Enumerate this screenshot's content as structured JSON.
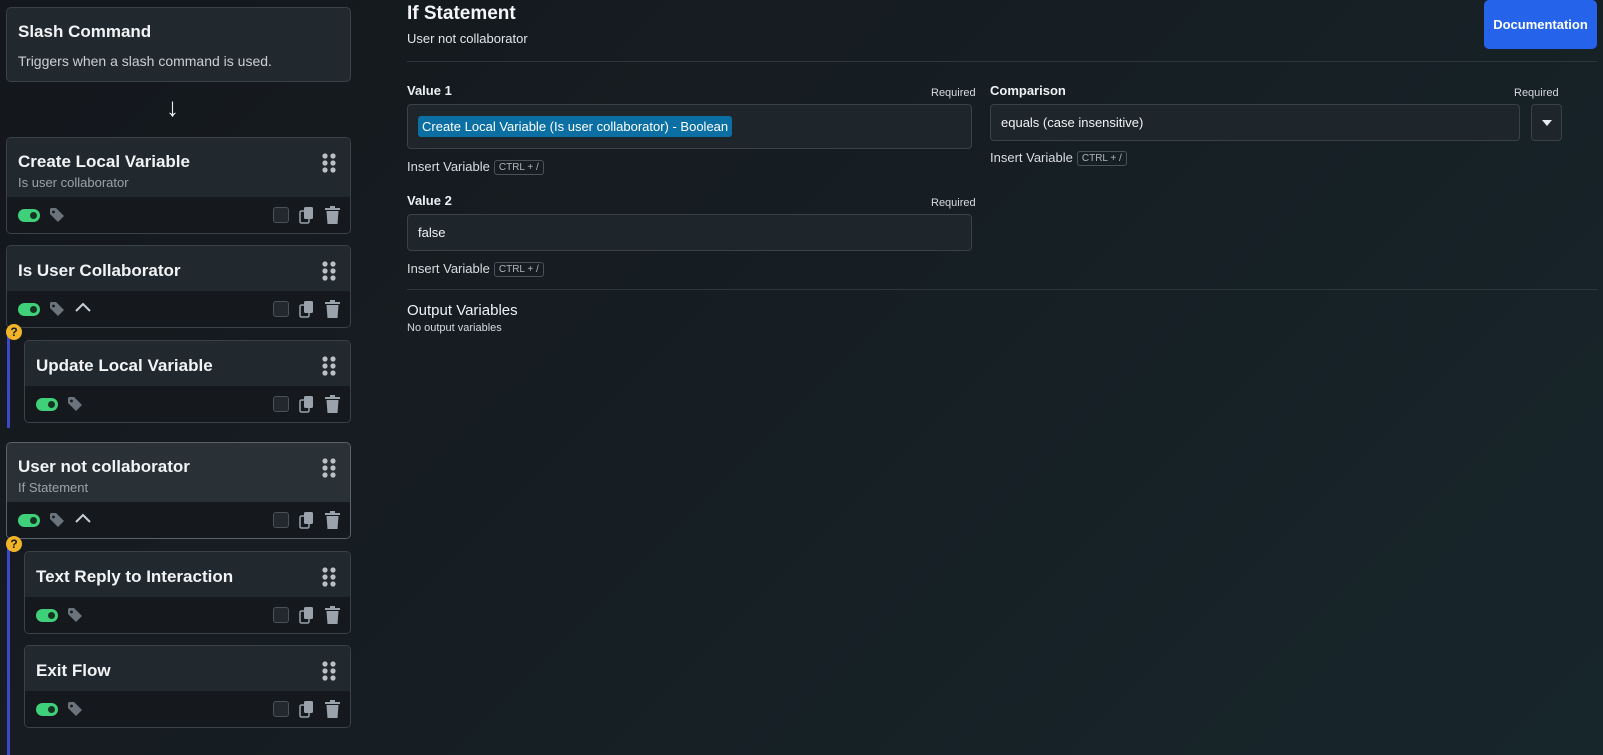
{
  "sidebar": {
    "trigger": {
      "title": "Slash Command",
      "description": "Triggers when a slash command is used."
    },
    "arrow": "↓",
    "blocks": [
      {
        "title": "Create Local Variable",
        "subtitle": "Is user collaborator"
      },
      {
        "title": "Is User Collaborator",
        "subtitle": ""
      },
      {
        "title": "Update Local Variable",
        "subtitle": ""
      },
      {
        "title": "User not collaborator",
        "subtitle": "If Statement"
      },
      {
        "title": "Text Reply to Interaction",
        "subtitle": ""
      },
      {
        "title": "Exit Flow",
        "subtitle": ""
      }
    ],
    "branch_marker": "?"
  },
  "main": {
    "title": "If Statement",
    "subtitle": "User not collaborator",
    "documentation_label": "Documentation",
    "value1": {
      "label": "Value 1",
      "required": "Required",
      "chip": "Create Local Variable (Is user collaborator) - Boolean",
      "insert_label": "Insert Variable",
      "shortcut": "CTRL + /"
    },
    "comparison": {
      "label": "Comparison",
      "required": "Required",
      "value": "equals (case insensitive)",
      "insert_label": "Insert Variable",
      "shortcut": "CTRL + /"
    },
    "value2": {
      "label": "Value 2",
      "required": "Required",
      "value": "false",
      "insert_label": "Insert Variable",
      "shortcut": "CTRL + /"
    },
    "output": {
      "title": "Output Variables",
      "empty": "No output variables"
    }
  },
  "colors": {
    "accent": "#2563eb",
    "toggle_on": "#3fd07a",
    "branch_line": "#3b49c8",
    "warning": "#f0b429",
    "chip": "#0b6fa4"
  },
  "icons": [
    "arrow-down-icon",
    "drag-handle-icon",
    "toggle-icon",
    "tag-icon",
    "chevron-up-icon",
    "checkbox-icon",
    "copy-icon",
    "trash-icon",
    "question-icon",
    "caret-down-icon"
  ]
}
